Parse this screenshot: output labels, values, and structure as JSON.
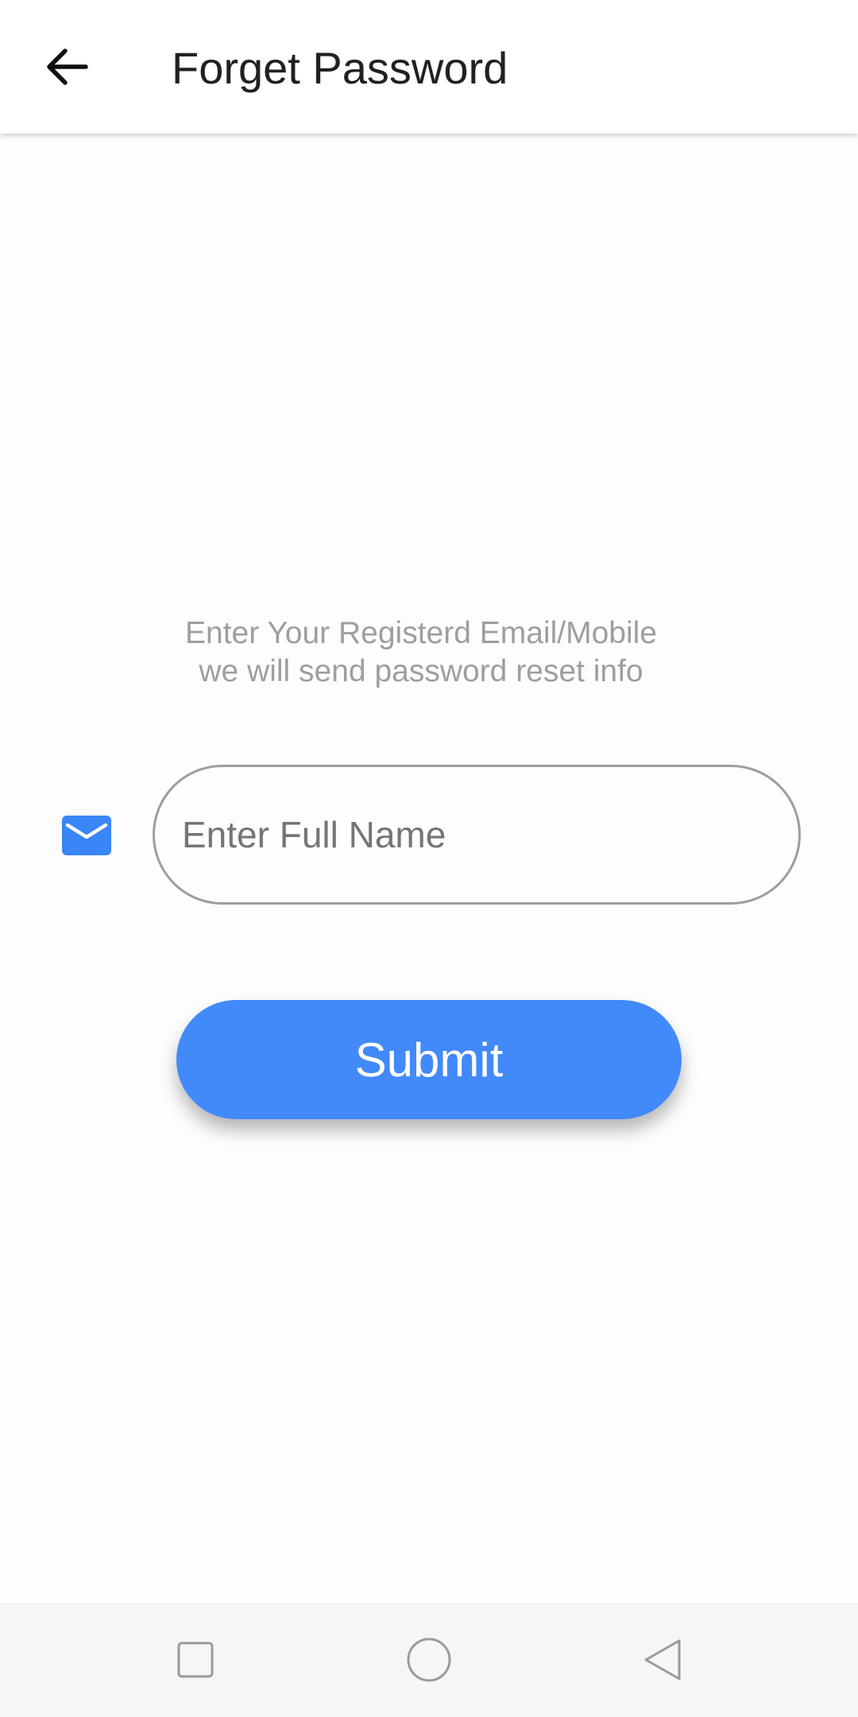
{
  "app_bar": {
    "title": "Forget Password",
    "back_icon": "arrow-left-icon"
  },
  "form": {
    "instruction_line1": "Enter Your Registerd Email/Mobile",
    "instruction_line2": "we will send password reset info",
    "input_icon": "mail-icon",
    "input_placeholder": "Enter Full Name",
    "input_value": "",
    "submit_label": "Submit"
  },
  "nav_bar": {
    "recents_icon": "square-icon",
    "home_icon": "circle-icon",
    "back_icon": "triangle-back-icon"
  },
  "colors": {
    "accent": "#4289fa",
    "title_text": "#212121",
    "hint_text": "#9e9e9e",
    "input_border": "#9e9e9e",
    "nav_bar_bg": "#f6f6f6"
  }
}
